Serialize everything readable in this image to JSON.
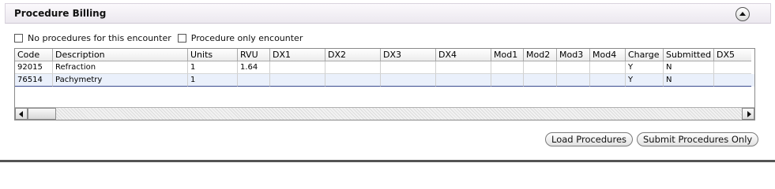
{
  "panel": {
    "title": "Procedure Billing"
  },
  "options": {
    "no_procedures": "No procedures for this encounter",
    "procedure_only": "Procedure only encounter"
  },
  "grid": {
    "columns": [
      "Code",
      "Description",
      "Units",
      "RVU",
      "DX1",
      "DX2",
      "DX3",
      "DX4",
      "Mod1",
      "Mod2",
      "Mod3",
      "Mod4",
      "Charge",
      "Submitted",
      "DX5"
    ],
    "rows": [
      [
        "92015",
        "Refraction",
        "1",
        "1.64",
        "",
        "",
        "",
        "",
        "",
        "",
        "",
        "",
        "Y",
        "N",
        ""
      ],
      [
        "76514",
        "Pachymetry",
        "1",
        "",
        "",
        "",
        "",
        "",
        "",
        "",
        "",
        "",
        "Y",
        "N",
        ""
      ]
    ]
  },
  "buttons": {
    "load": "Load Procedures",
    "submit": "Submit Procedures Only"
  }
}
